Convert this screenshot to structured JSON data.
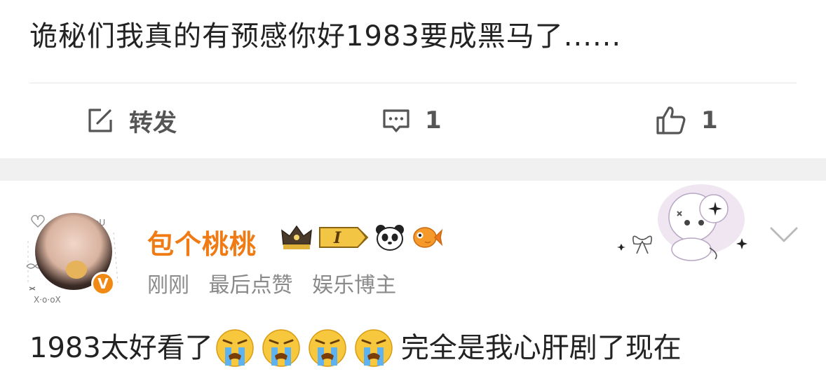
{
  "post": {
    "text": "诡秘们我真的有预感你好1983要成黑马了......"
  },
  "actions": {
    "repost_label": "转发",
    "comment_count": "1",
    "like_count": "1"
  },
  "comment": {
    "username": "包个桃桃",
    "level_badge": "I",
    "verified_mark": "V",
    "meta": {
      "time": "刚刚",
      "last_like": "最后点赞",
      "role": "娱乐博主"
    },
    "text_before": "1983太好看了",
    "text_after": "完全是我心肝剧了现在",
    "emojis": [
      "crying-face",
      "crying-face",
      "crying-face",
      "crying-face"
    ]
  },
  "colors": {
    "username": "#f07a13",
    "meta_text": "#8a8a8a",
    "body_text": "#222222",
    "icon_gray": "#555555",
    "separator": "#f0f0f0"
  },
  "icons": [
    "edit-square-icon",
    "comment-bubble-icon",
    "thumbs-up-icon",
    "chevron-down-icon",
    "crown-icon",
    "panda-icon",
    "goldfish-icon",
    "verified-v-icon"
  ]
}
